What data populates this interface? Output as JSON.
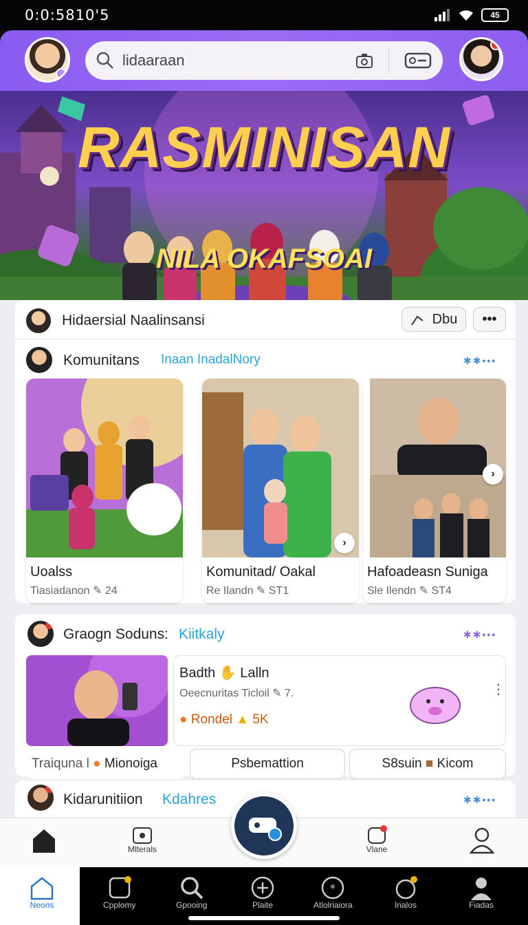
{
  "status_bar": {
    "time": "0:0:5810'5"
  },
  "header": {
    "search": {
      "value": "lidaaraan"
    }
  },
  "banner": {
    "title": "RASMINISAN",
    "subtitle": "NILA OKAFSOAI"
  },
  "section1": {
    "title": "Hidaersial Naalinsansi",
    "action_label": "Dbu",
    "sub_title": "Komunitans",
    "sub_link": "Inaan InadalNory",
    "tiles": [
      {
        "title": "Uoalss",
        "meta": "Tiasiadanon",
        "count": "24"
      },
      {
        "title": "Komunitad/ Oakal",
        "meta": "Re Ilandn",
        "count": "ST1"
      },
      {
        "title": "Hafoadeasn Suniga",
        "meta": "Sle Ilendn",
        "count": "ST4"
      }
    ]
  },
  "section2": {
    "title": "Graogn Soduns:",
    "title_link": "Kiitkaly",
    "feature": {
      "title": "Badth",
      "title2": "Lalln",
      "subtitle": "Oeecnuritas Ticloil",
      "sub_count": "7.",
      "tag": "Rondel",
      "count": "5K"
    },
    "buttons": [
      {
        "label": "Traiquna l",
        "label2": "Mionoiga"
      },
      {
        "label": "Psbemattion"
      },
      {
        "label": "S8suin",
        "label2": "Kicom"
      }
    ]
  },
  "section3": {
    "title": "Kidarunitiion",
    "title_link": "Kdahres"
  },
  "nav_primary": {
    "items": [
      {
        "label": ""
      },
      {
        "label": "Mlterals"
      },
      {
        "label": "Vlane"
      },
      {
        "label": ""
      }
    ]
  },
  "nav_secondary": {
    "items": [
      {
        "label": "Neons"
      },
      {
        "label": "Cpplomy"
      },
      {
        "label": "Gpooing"
      },
      {
        "label": "Plaite"
      },
      {
        "label": "Atlolriaiora"
      },
      {
        "label": "Inalos"
      },
      {
        "label": "Fiadas"
      }
    ]
  },
  "colors": {
    "header": "#9b6cf5",
    "accent_link": "#2aa3d9",
    "fab": "#1f3658",
    "badge": "#e53935"
  },
  "icons": [
    "search-icon",
    "camera-icon",
    "vr-icon",
    "home-icon",
    "materials-icon",
    "view-icon",
    "profile-icon",
    "neons-icon",
    "community-icon",
    "group-search-icon",
    "plus-circle-icon",
    "activity-icon",
    "music-icon",
    "person-icon"
  ]
}
